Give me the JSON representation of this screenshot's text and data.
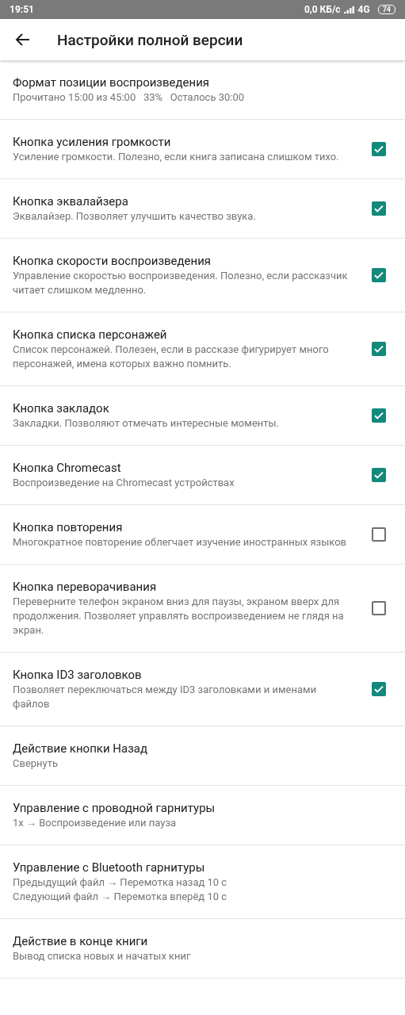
{
  "status_bar": {
    "time": "19:51",
    "speed": "0,0 КБ/с",
    "network": "4G",
    "battery": "74"
  },
  "app_bar": {
    "title": "Настройки полной версии"
  },
  "settings": [
    {
      "kind": "plain",
      "title": "Формат позиции воспроизведения",
      "summary_lines": [
        "Прочитано 15:00 из 45:00   33%   Осталось 30:00"
      ]
    },
    {
      "kind": "checkbox",
      "title": "Кнопка усиления громкости",
      "summary_lines": [
        "Усиление громкости. Полезно, если книга записана слишком тихо."
      ],
      "checked": true
    },
    {
      "kind": "checkbox",
      "title": "Кнопка эквалайзера",
      "summary_lines": [
        "Эквалайзер. Позволяет улучшить качество звука."
      ],
      "checked": true
    },
    {
      "kind": "checkbox",
      "title": "Кнопка скорости воспроизведения",
      "summary_lines": [
        "Управление скоростью воспроизведения. Полезно, если рассказчик читает слишком медленно."
      ],
      "checked": true
    },
    {
      "kind": "checkbox",
      "title": "Кнопка списка персонажей",
      "summary_lines": [
        "Список персонажей. Полезен, если в рассказе фигурирует много персонажей, имена которых важно помнить."
      ],
      "checked": true
    },
    {
      "kind": "checkbox",
      "title": "Кнопка закладок",
      "summary_lines": [
        "Закладки. Позволяют отмечать интересные моменты."
      ],
      "checked": true
    },
    {
      "kind": "checkbox",
      "title": "Кнопка Chromecast",
      "summary_lines": [
        "Воспроизведение на Chromecast устройствах"
      ],
      "checked": true
    },
    {
      "kind": "checkbox",
      "title": "Кнопка повторения",
      "summary_lines": [
        "Многократное повторение облегчает изучение иностранных языков"
      ],
      "checked": false
    },
    {
      "kind": "checkbox",
      "title": "Кнопка переворачивания",
      "summary_lines": [
        "Переверните телефон экраном вниз для паузы, экраном вверх для продолжения. Позволяет управлять воспроизведением не глядя на экран."
      ],
      "checked": false
    },
    {
      "kind": "checkbox",
      "title": "Кнопка ID3 заголовков",
      "summary_lines": [
        "Позволяет переключаться между ID3 заголовками и именами файлов"
      ],
      "checked": true
    },
    {
      "kind": "plain",
      "title": "Действие кнопки Назад",
      "summary_lines": [
        "Свернуть"
      ]
    },
    {
      "kind": "plain",
      "title": "Управление с проводной гарнитуры",
      "summary_lines": [
        "1x → Воспроизведение или пауза"
      ]
    },
    {
      "kind": "plain",
      "title": "Управление с Bluetooth гарнитуры",
      "summary_lines": [
        "Предыдущий файл → Перемотка назад 10 с",
        "Следующий файл → Перемотка вперёд 10 с"
      ]
    },
    {
      "kind": "plain",
      "title": "Действие в конце книги",
      "summary_lines": [
        "Вывод списка новых и начатых книг"
      ]
    }
  ]
}
